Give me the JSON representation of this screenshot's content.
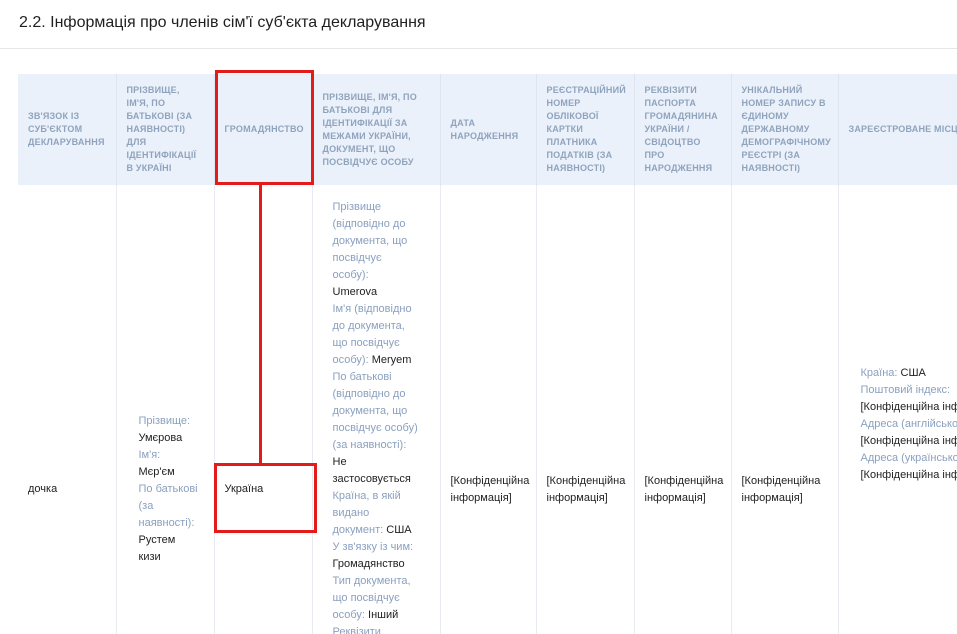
{
  "section": {
    "title": "2.2. Інформація про членів сім'ї суб'єкта декларування"
  },
  "table": {
    "headers": [
      "Зв'язок із суб'єктом декларування",
      "Прізвище, ім'я, по батькові (за наявності) для ідентифікації в Україні",
      "Громадянство",
      "Прізвище, ім'я, по батькові для ідентифікації за межами України, документ, що посвідчує особу",
      "Дата народження",
      "Реєстраційний номер облікової картки платника податків (за наявності)",
      "Реквізити паспорта громадянина України / свідоцтво про народження",
      "Унікальний номер запису в Єдиному державному демографічному реєстрі (за наявності)",
      "Зареєстроване місце проживання"
    ],
    "row": {
      "relation": "дочка",
      "name_ua": {
        "surname_label": "Прізвище:",
        "surname": "Умєрова",
        "first_label": "Ім'я:",
        "first": "Мєр'єм",
        "patronymic_label": "По батькові (за наявності):",
        "patronymic": "Рустем кизи"
      },
      "citizenship": "Україна",
      "foreign": {
        "surname_label": "Прізвище (відповідно до документа, що посвідчує особу):",
        "surname": "Umerova",
        "first_label": "Ім'я (відповідно до документа, що посвідчує особу):",
        "first": "Meryem",
        "patronymic_label": "По батькові (відповідно до документа, що посвідчує особу) (за наявності):",
        "patronymic": "Не застосовується",
        "country_label": "Країна, в якій видано документ:",
        "country": "США",
        "relation_label": "У зв'язку із чим:",
        "relation": "Громадянство",
        "doctype_label": "Тип документа, що посвідчує особу:",
        "doctype": "Інший",
        "details_label": "Реквізити"
      },
      "birth_date": "[Конфіденційна інформація]",
      "tax_number": "[Конфіденційна інформація]",
      "passport": "[Конфіденційна інформація]",
      "registry_number": "[Конфіденційна інформація]",
      "residence": {
        "country_label": "Країна:",
        "country": "США",
        "postal_label": "Поштовий індекс:",
        "postal": "[Конфіденційна інформація]",
        "address_en_label": "Адреса (англійською):",
        "address_en": "[Конфіденційна інформація]",
        "address_ua_label": "Адреса (українською):",
        "address_ua": "[Конфіденційна інформація]"
      }
    }
  },
  "highlight_color": "#e31b1b"
}
